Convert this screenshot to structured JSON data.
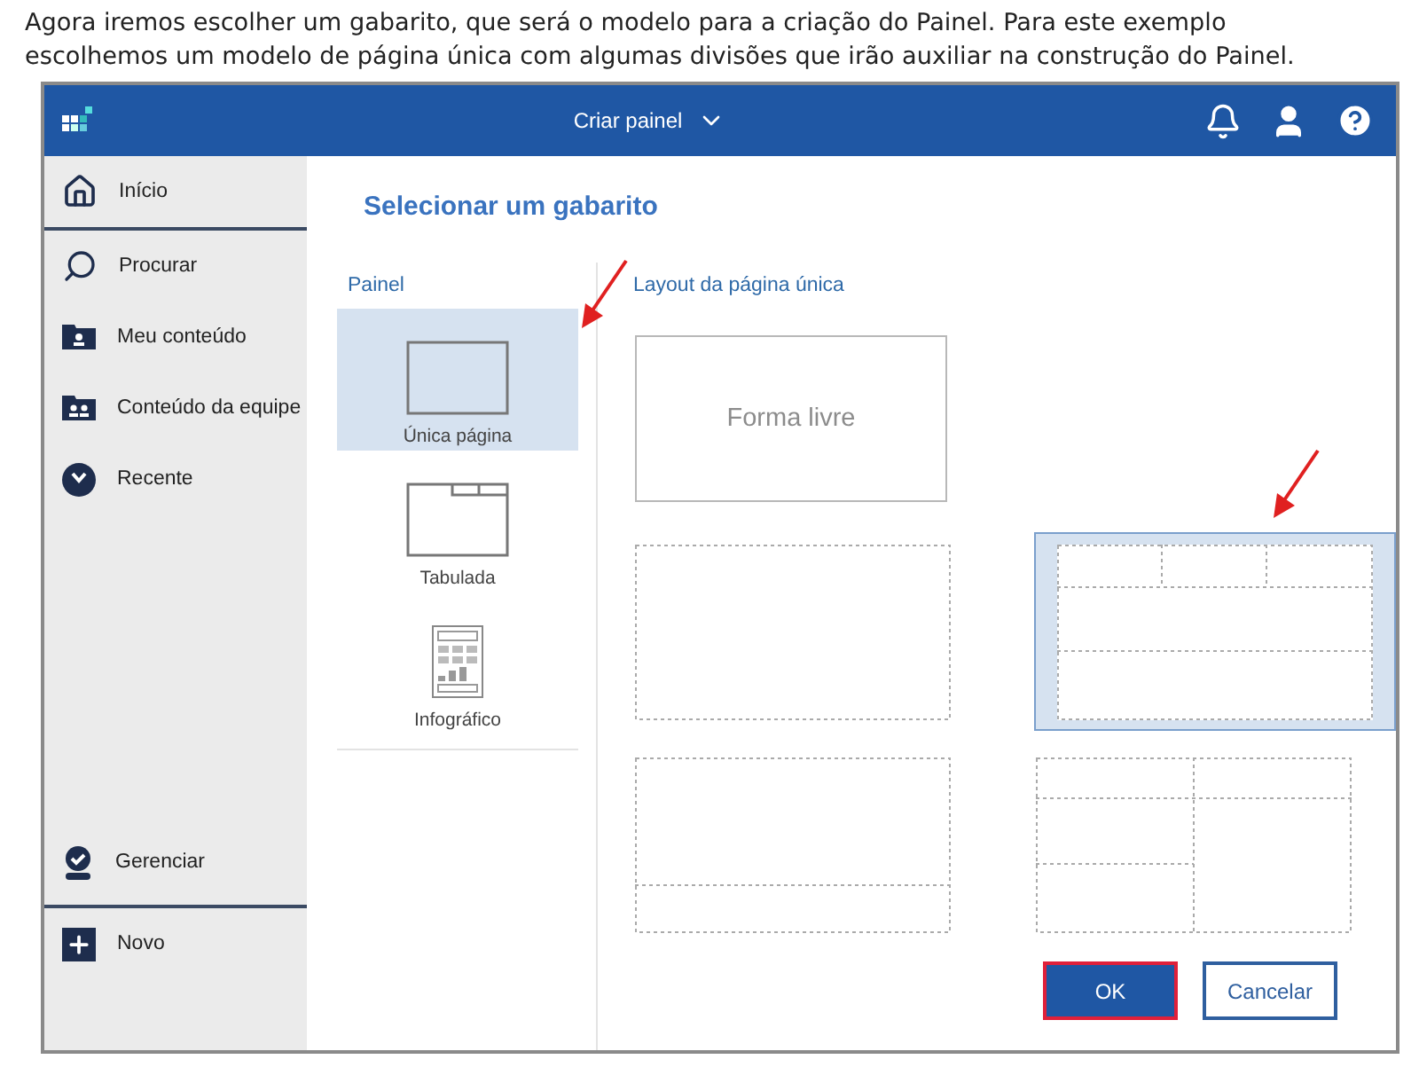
{
  "intro": "Agora iremos escolher um gabarito, que será o modelo para a criação do Painel. Para este exemplo\nescolhemos um modelo de página única com algumas divisões que irão auxiliar na construção do Painel.",
  "app": {
    "topbar": {
      "title": "Criar painel"
    },
    "sidebar": {
      "top": [
        {
          "kind": "home",
          "label": "Início"
        },
        {
          "kind": "search",
          "label": "Procurar"
        },
        {
          "kind": "my-content",
          "label": "Meu conteúdo"
        },
        {
          "kind": "team-content",
          "label": "Conteúdo da equipe"
        },
        {
          "kind": "recent",
          "label": "Recente"
        }
      ],
      "bottom": [
        {
          "kind": "manage",
          "label": "Gerenciar"
        },
        {
          "kind": "new",
          "label": "Novo"
        }
      ]
    },
    "heading": "Selecionar um gabarito",
    "panel_types": {
      "label": "Painel",
      "items": [
        {
          "kind": "single",
          "label": "Única página",
          "selected": true
        },
        {
          "kind": "tabbed",
          "label": "Tabulada",
          "selected": false
        },
        {
          "kind": "infographic",
          "label": "Infográfico",
          "selected": false
        }
      ]
    },
    "layouts": {
      "label": "Layout da página única",
      "items": [
        {
          "kind": "free",
          "text": "Forma livre",
          "selected": false
        },
        {
          "kind": "empty",
          "selected": false
        },
        {
          "kind": "header-three",
          "selected": true
        },
        {
          "kind": "footer",
          "selected": false
        },
        {
          "kind": "grid",
          "selected": false
        }
      ]
    },
    "buttons": [
      {
        "kind": "primary",
        "label": "OK"
      },
      {
        "kind": "secondary",
        "label": "Cancelar"
      }
    ]
  }
}
